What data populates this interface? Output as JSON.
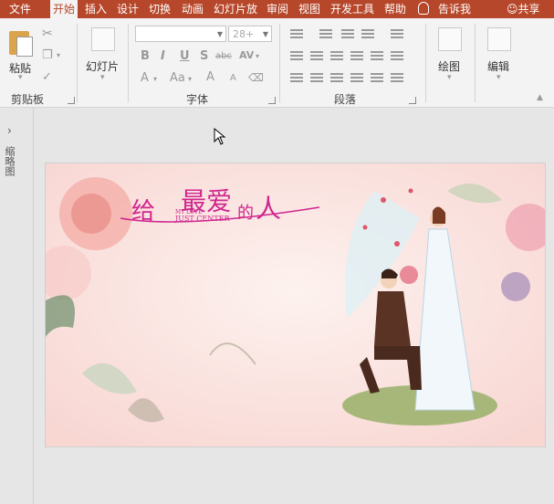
{
  "tabs": {
    "file": "文件",
    "home": "开始",
    "insert": "插入",
    "design": "设计",
    "transition": "切换",
    "animation": "动画",
    "slideshow": "幻灯片放映",
    "review": "审阅",
    "view": "视图",
    "developer": "开发工具",
    "help": "帮助"
  },
  "tell_me": "告诉我",
  "share": "共享",
  "ribbon": {
    "clipboard": {
      "paste": "粘贴",
      "group_label": "剪贴板"
    },
    "slides": {
      "new_slide": "幻灯片"
    },
    "font": {
      "font_name": "",
      "font_size": "28+",
      "group_label": "字体",
      "bold": "B",
      "italic": "I",
      "underline": "U",
      "shadow": "S",
      "strike": "abc",
      "spacing": "AV",
      "font_color": "A",
      "change_case": "Aa",
      "grow": "A",
      "shrink": "A"
    },
    "paragraph": {
      "group_label": "段落"
    },
    "drawing": {
      "label": "绘图"
    },
    "editing": {
      "label": "编辑"
    }
  },
  "rail": {
    "label": "缩略图"
  },
  "slide": {
    "title_part1": "给",
    "title_part2": "最爱",
    "title_part3": "的",
    "title_part4": "人",
    "subtitle_line1": "MY LOVE",
    "subtitle_line2": "JUST CENTER"
  },
  "colors": {
    "accent": "#b7472a",
    "ribbon_bg": "#f3f3f3",
    "title_magenta": "#d0268f",
    "slide_bg": "#fbe7e4"
  }
}
